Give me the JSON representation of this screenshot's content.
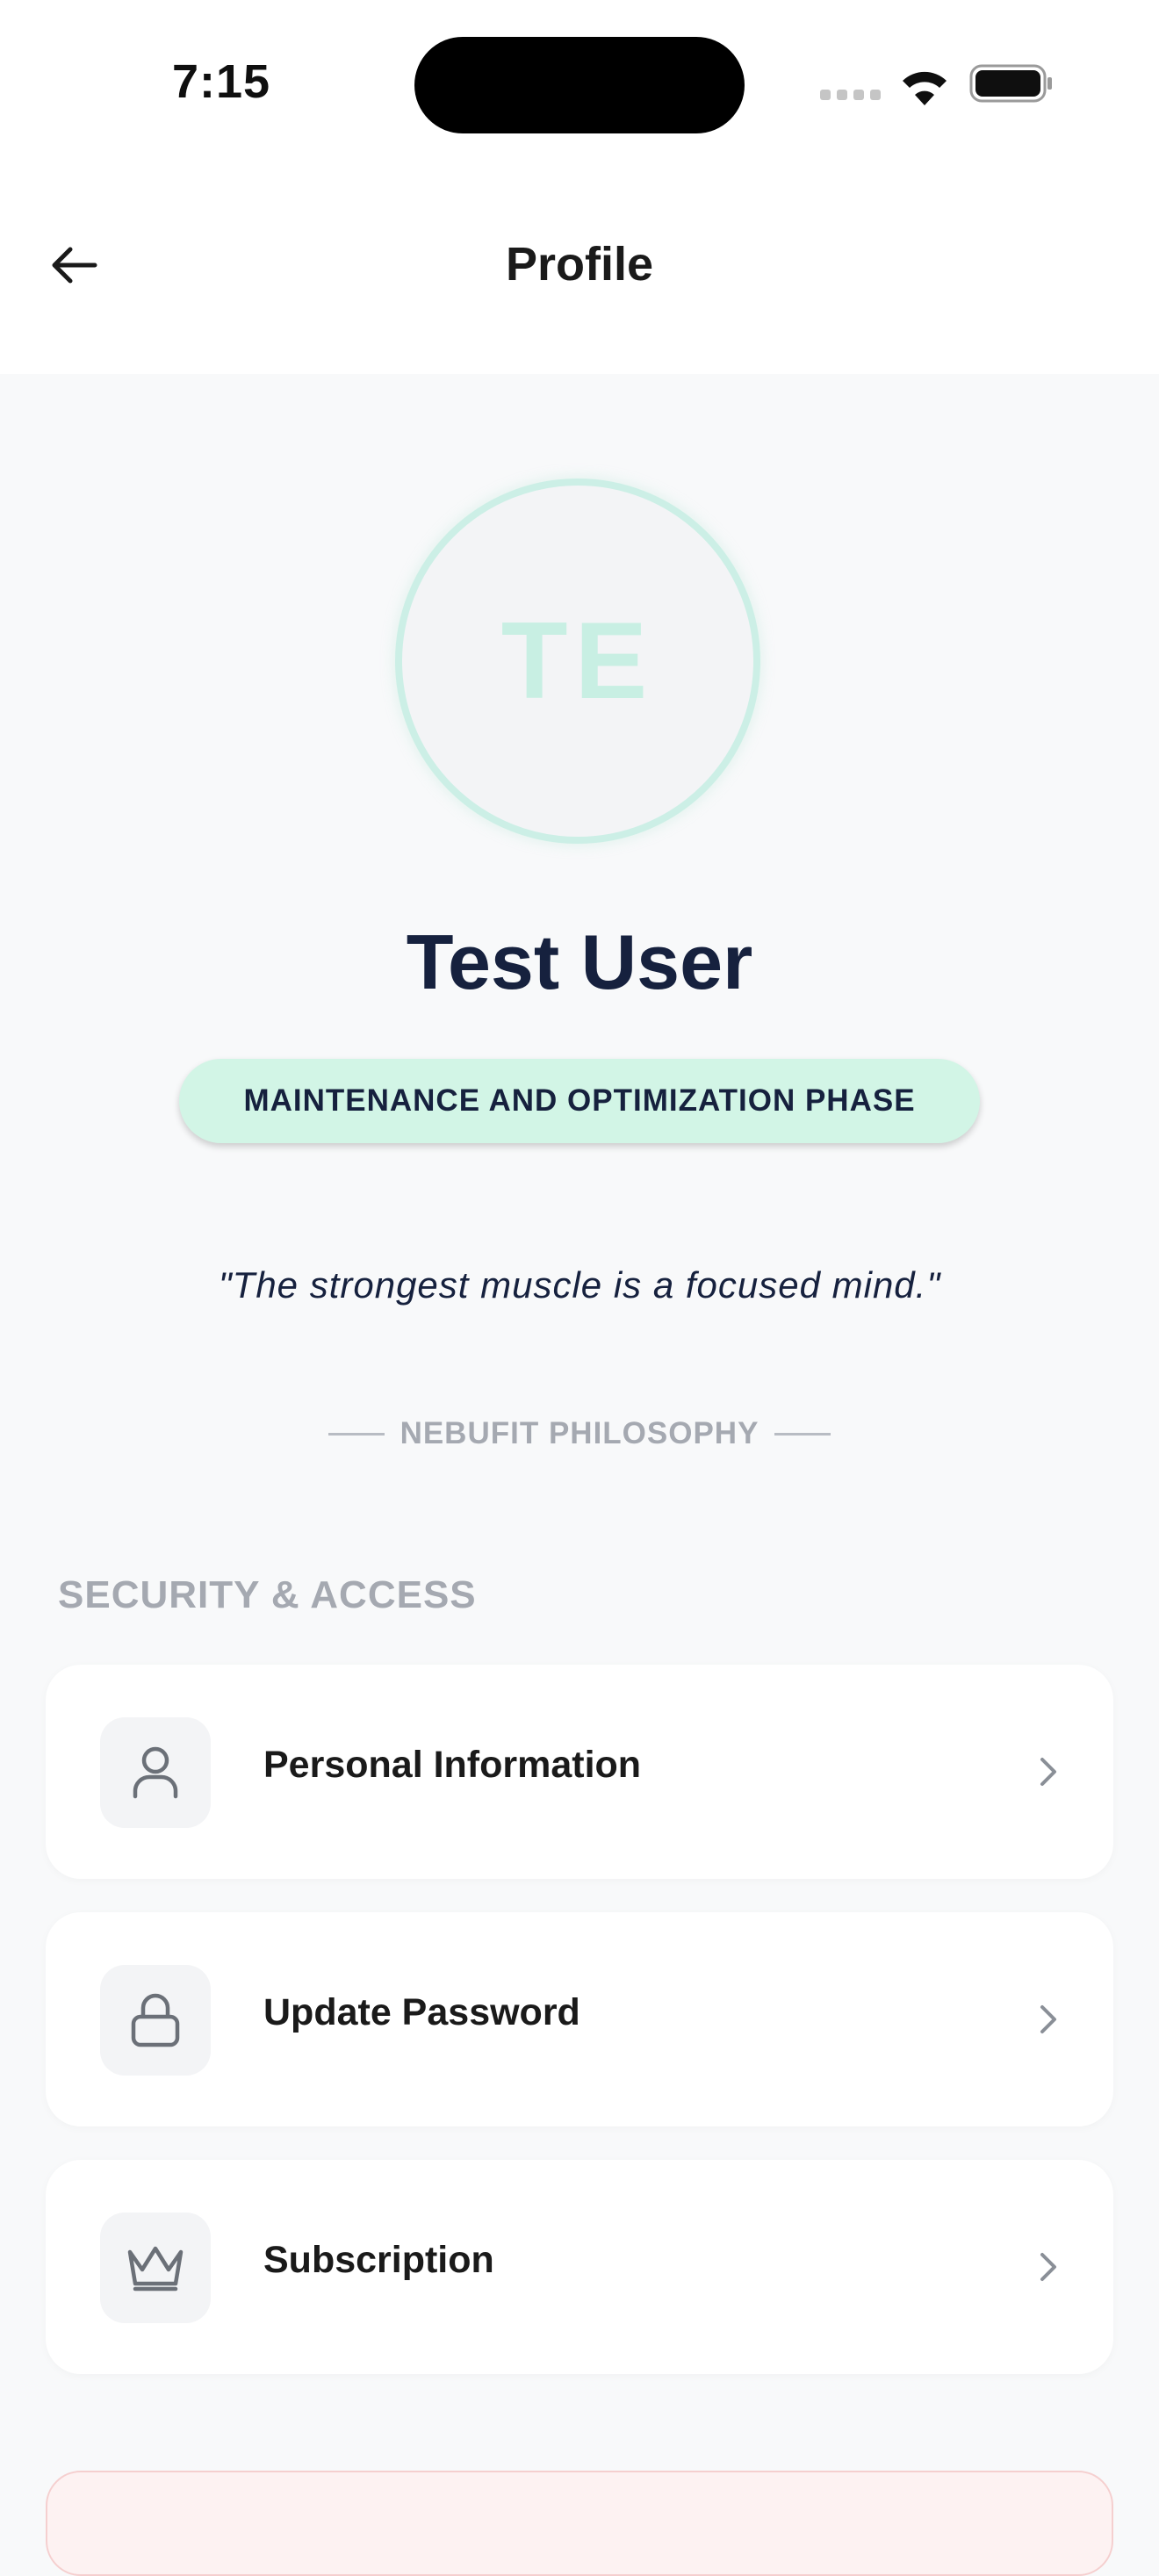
{
  "status_bar": {
    "time": "7:15"
  },
  "header": {
    "title": "Profile"
  },
  "profile": {
    "initials": "TE",
    "name": "Test User",
    "phase": "MAINTENANCE AND OPTIMIZATION PHASE",
    "quote": "\"The strongest muscle is a focused mind.\"",
    "philosophy_label": "NEBUFIT PHILOSOPHY"
  },
  "security": {
    "title": "SECURITY & ACCESS",
    "items": [
      {
        "label": "Personal Information",
        "icon": "user-icon"
      },
      {
        "label": "Update Password",
        "icon": "lock-icon"
      },
      {
        "label": "Subscription",
        "icon": "crown-icon"
      }
    ]
  },
  "colors": {
    "accent_mint": "#d2f5e6",
    "avatar_ring": "#ccefe6",
    "navy_text": "#16213e",
    "muted_text": "#a5a9b1",
    "danger_bg": "#fdf2f2"
  }
}
